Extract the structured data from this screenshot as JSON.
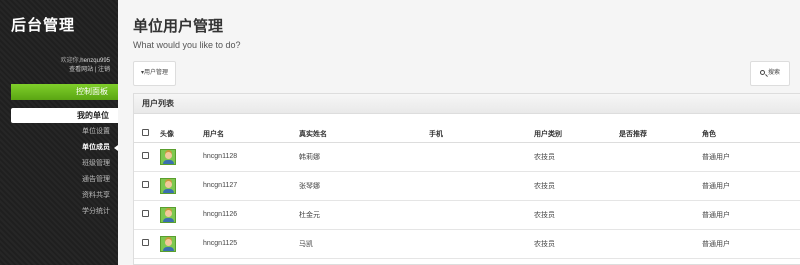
{
  "sidebar": {
    "brand": "后台管理",
    "welcome_prefix": "欢迎你,",
    "welcome_user": "henzqu995",
    "links_text": "查看网站 | 注销",
    "dashboard_label": "控制面板",
    "section_label": "我的单位",
    "items": [
      {
        "label": "单位设置",
        "active": false
      },
      {
        "label": "单位成员",
        "active": true
      },
      {
        "label": "班级管理",
        "active": false
      },
      {
        "label": "通告管理",
        "active": false
      },
      {
        "label": "资料共享",
        "active": false
      },
      {
        "label": "学分统计",
        "active": false
      }
    ]
  },
  "main": {
    "title": "单位用户管理",
    "subtitle": "What would you like to do?",
    "user_menu_label": "▾用户管理",
    "search_label": "搜索"
  },
  "panel": {
    "title": "用户列表",
    "headers": [
      "",
      "头像",
      "用户名",
      "真实姓名",
      "手机",
      "用户类别",
      "是否推荐",
      "角色"
    ],
    "rows": [
      {
        "username": "hncgn1128",
        "realname": "韩莉娜",
        "phone": "",
        "type": "农技员",
        "recommended": "",
        "role": "普通用户"
      },
      {
        "username": "hncgn1127",
        "realname": "张琴娜",
        "phone": "",
        "type": "农技员",
        "recommended": "",
        "role": "普通用户"
      },
      {
        "username": "hncgn1126",
        "realname": "杜金元",
        "phone": "",
        "type": "农技员",
        "recommended": "",
        "role": "普通用户"
      },
      {
        "username": "hncgn1125",
        "realname": "马凯",
        "phone": "",
        "type": "农技员",
        "recommended": "",
        "role": "普通用户"
      }
    ]
  },
  "colors": {
    "accent_green": "#5aa513",
    "sidebar_bg": "#222222"
  },
  "icons": {
    "search": "search-icon",
    "avatar": "user-avatar-icon"
  }
}
